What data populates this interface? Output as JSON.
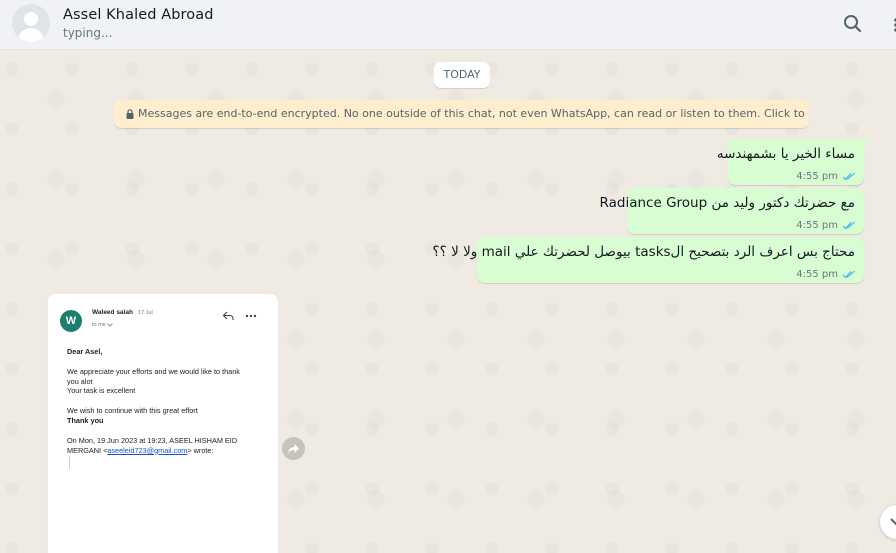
{
  "header": {
    "contact_name": "Assel Khaled Abroad",
    "status": "typing...",
    "search_icon": "search-icon",
    "menu_icon": "menu-icon"
  },
  "chat": {
    "date_chip": "TODAY",
    "encryption_notice": "Messages are end-to-end encrypted. No one outside of this chat, not even WhatsApp, can read or listen to them. Click to learn more.",
    "messages": [
      {
        "direction": "out",
        "text": "مساء الخير يا بشمهندسه",
        "time": "4:55 pm",
        "status": "read"
      },
      {
        "direction": "out",
        "text": "مع حضرتك دكتور وليد من Radiance Group",
        "time": "4:55 pm",
        "status": "read"
      },
      {
        "direction": "out",
        "text": "محتاج بس اعرف الرد بتصحيح الtasks بيوصل لحضرتك علي mail ولا لا ؟؟",
        "time": "4:55 pm",
        "status": "read"
      }
    ],
    "image_message": {
      "direction": "in",
      "email": {
        "avatar_letter": "W",
        "sender": "Waleed salah",
        "date": "17 Jul",
        "to": "to me",
        "greeting": "Dear Asel,",
        "line1": "We appreciate your efforts and we would like to thank",
        "line2": "you alot",
        "line3": "Your task is excellent",
        "line4": "We wish to continue with this great effort",
        "line5": "Thank you",
        "quote_line1": "On Mon, 19 Jun 2023 at 19:23, ASEEL HISHAM EID",
        "quote_prefix": "MERGANI <",
        "quote_email": "aseeleid723@gmail.com",
        "quote_suffix": "> wrote:"
      }
    },
    "accent_color": "#d9fdd3",
    "tick_color": "#53bdeb"
  }
}
